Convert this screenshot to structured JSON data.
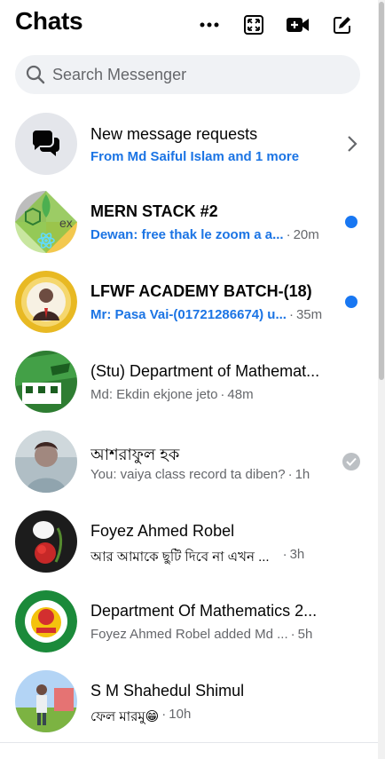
{
  "header": {
    "title": "Chats",
    "icons": [
      "more-options-icon",
      "expand-icon",
      "new-room-video-icon",
      "compose-icon"
    ]
  },
  "search": {
    "placeholder": "Search Messenger"
  },
  "requests": {
    "title": "New message requests",
    "subtitle": "From Md Saiful Islam and 1 more"
  },
  "chats": [
    {
      "name": "MERN STACK #2",
      "message": "Dewan: free thak le zoom a a...",
      "time": "20m",
      "unread": true
    },
    {
      "name": "LFWF ACADEMY BATCH-(18)",
      "message": "Mr: Pasa Vai-(01721286674) u...",
      "time": "35m",
      "unread": true
    },
    {
      "name": "(Stu) Department of Mathemat...",
      "message": "Md: Ekdin ekjone jeto",
      "time": "48m",
      "unread": false
    },
    {
      "name": "আশরাফুল হক",
      "message": "You: vaiya class record ta diben?",
      "time": "1h",
      "unread": false,
      "seen": true
    },
    {
      "name": "Foyez Ahmed Robel",
      "message": "আর আমাকে ছুটি দিবে না এখন ...",
      "time": "3h",
      "unread": false
    },
    {
      "name": "Department Of Mathematics 2...",
      "message": "Foyez Ahmed Robel added Md ...",
      "time": "5h",
      "unread": false
    },
    {
      "name": "S M Shahedul Shimul",
      "message": "ফেল মারমু😁",
      "time": "10h",
      "unread": false
    }
  ],
  "colors": {
    "accent": "#1877f2",
    "link": "#1b74e4",
    "muted": "#65676b",
    "search_bg": "#f0f2f5"
  }
}
